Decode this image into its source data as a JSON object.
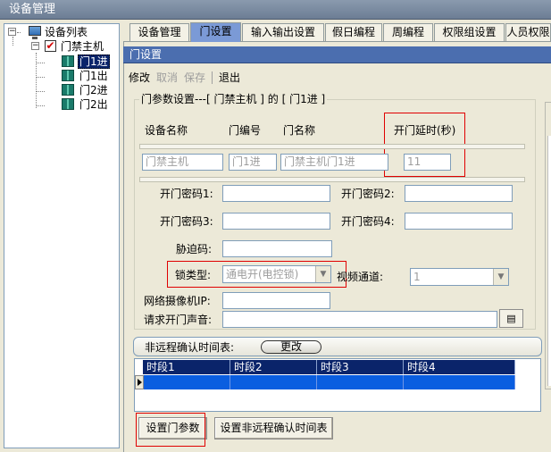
{
  "window": {
    "title": "设备管理"
  },
  "tree": {
    "root": "设备列表",
    "controller": "门禁主机",
    "doors": [
      "门1进",
      "门1出",
      "门2进",
      "门2出"
    ]
  },
  "tabs": [
    "设备管理",
    "门设置",
    "输入输出设置",
    "假日编程",
    "周编程",
    "权限组设置",
    "人员权限"
  ],
  "active_tab": "门设置",
  "panel": {
    "title": "门设置"
  },
  "toolbar": {
    "modify": "修改",
    "cancel": "取消",
    "save": "保存",
    "exit": "退出"
  },
  "door_params": {
    "group_title": "门参数设置---[ 门禁主机 ] 的 [ 门1进 ]",
    "col_device_name": "设备名称",
    "col_door_no": "门编号",
    "col_door_name": "门名称",
    "col_open_delay": "开门延时(秒)",
    "device_name": "门禁主机",
    "door_no": "门1进",
    "door_name": "门禁主机门1进",
    "open_delay": "11",
    "pwd1_label": "开门密码1:",
    "pwd2_label": "开门密码2:",
    "pwd3_label": "开门密码3:",
    "pwd4_label": "开门密码4:",
    "duress_label": "胁迫码:",
    "lock_type_label": "锁类型:",
    "lock_type_value": "通电开(电控锁)",
    "video_channel_label": "视频通道:",
    "video_channel_value": "1",
    "camera_ip_label": "网络摄像机IP:",
    "open_sound_label": "请求开门声音:"
  },
  "non_remote": {
    "label": "非远程确认时间表:",
    "change_button": "更改",
    "columns": [
      "时段1",
      "时段2",
      "时段3",
      "时段4"
    ]
  },
  "buttons": {
    "set_door_params": "设置门参数",
    "set_non_remote": "设置非远程确认时间表"
  }
}
